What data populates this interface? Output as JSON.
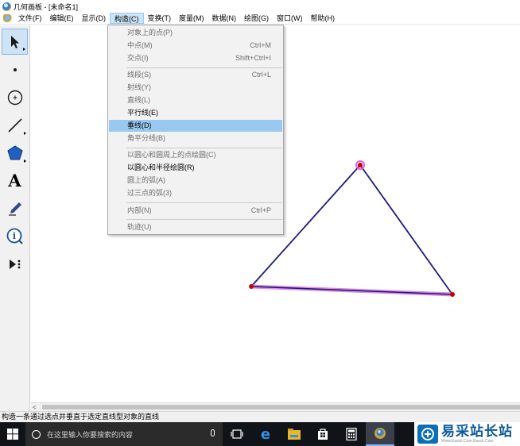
{
  "window": {
    "title": "几何画板 - [未命名1]"
  },
  "menubar": {
    "items": [
      "文件(F)",
      "编辑(E)",
      "显示(D)",
      "构造(C)",
      "变换(T)",
      "度量(M)",
      "数据(N)",
      "绘图(G)",
      "窗口(W)",
      "帮助(H)"
    ],
    "active_index": 3
  },
  "construct_menu": {
    "items": [
      {
        "label": "对象上的点(P)",
        "shortcut": "",
        "enabled": false
      },
      {
        "label": "中点(M)",
        "shortcut": "Ctrl+M",
        "enabled": false
      },
      {
        "label": "交点(I)",
        "shortcut": "Shift+Ctrl+I",
        "enabled": false
      },
      {
        "label": "线段(S)",
        "shortcut": "Ctrl+L",
        "enabled": false
      },
      {
        "label": "射线(Y)",
        "shortcut": "",
        "enabled": false
      },
      {
        "label": "直线(L)",
        "shortcut": "",
        "enabled": false
      },
      {
        "label": "平行线(E)",
        "shortcut": "",
        "enabled": true
      },
      {
        "label": "垂线(D)",
        "shortcut": "",
        "enabled": true,
        "highlighted": true
      },
      {
        "label": "角平分线(B)",
        "shortcut": "",
        "enabled": false
      },
      {
        "label": "以圆心和圆周上的点绘圆(C)",
        "shortcut": "",
        "enabled": false
      },
      {
        "label": "以圆心和半径绘圆(R)",
        "shortcut": "",
        "enabled": true
      },
      {
        "label": "圆上的弧(A)",
        "shortcut": "",
        "enabled": false
      },
      {
        "label": "过三点的弧(3)",
        "shortcut": "",
        "enabled": false
      },
      {
        "label": "内部(N)",
        "shortcut": "Ctrl+P",
        "enabled": false
      },
      {
        "label": "轨迹(U)",
        "shortcut": "",
        "enabled": false
      }
    ]
  },
  "toolbox": {
    "tools": [
      {
        "name": "arrow-select-tool-icon",
        "selected": true
      },
      {
        "name": "point-tool-icon"
      },
      {
        "name": "compass-tool-icon"
      },
      {
        "name": "straightedge-tool-icon"
      },
      {
        "name": "polygon-tool-icon"
      },
      {
        "name": "text-tool-icon",
        "glyph": "A"
      },
      {
        "name": "marker-tool-icon"
      },
      {
        "name": "information-tool-icon"
      },
      {
        "name": "custom-tool-icon"
      }
    ]
  },
  "figure": {
    "description_colors": {
      "triangle_edge": "#1b1b7c",
      "selected_edge": "#cc55cc",
      "point": "#cc0000"
    }
  },
  "statusbar": {
    "text": "构造一条通过选点并垂直于选定直线型对象的直线"
  },
  "taskbar": {
    "search_placeholder": "在这里输入你要搜索的内容",
    "icons": [
      "windows-start-icon",
      "task-view-icon",
      "edge-browser-icon",
      "file-explorer-icon",
      "store-icon",
      "calculator-icon",
      "sketchpad-app-icon"
    ]
  },
  "watermark": {
    "main": "易采站长站",
    "sub": "Www.Easck.Com Easck.Com"
  }
}
